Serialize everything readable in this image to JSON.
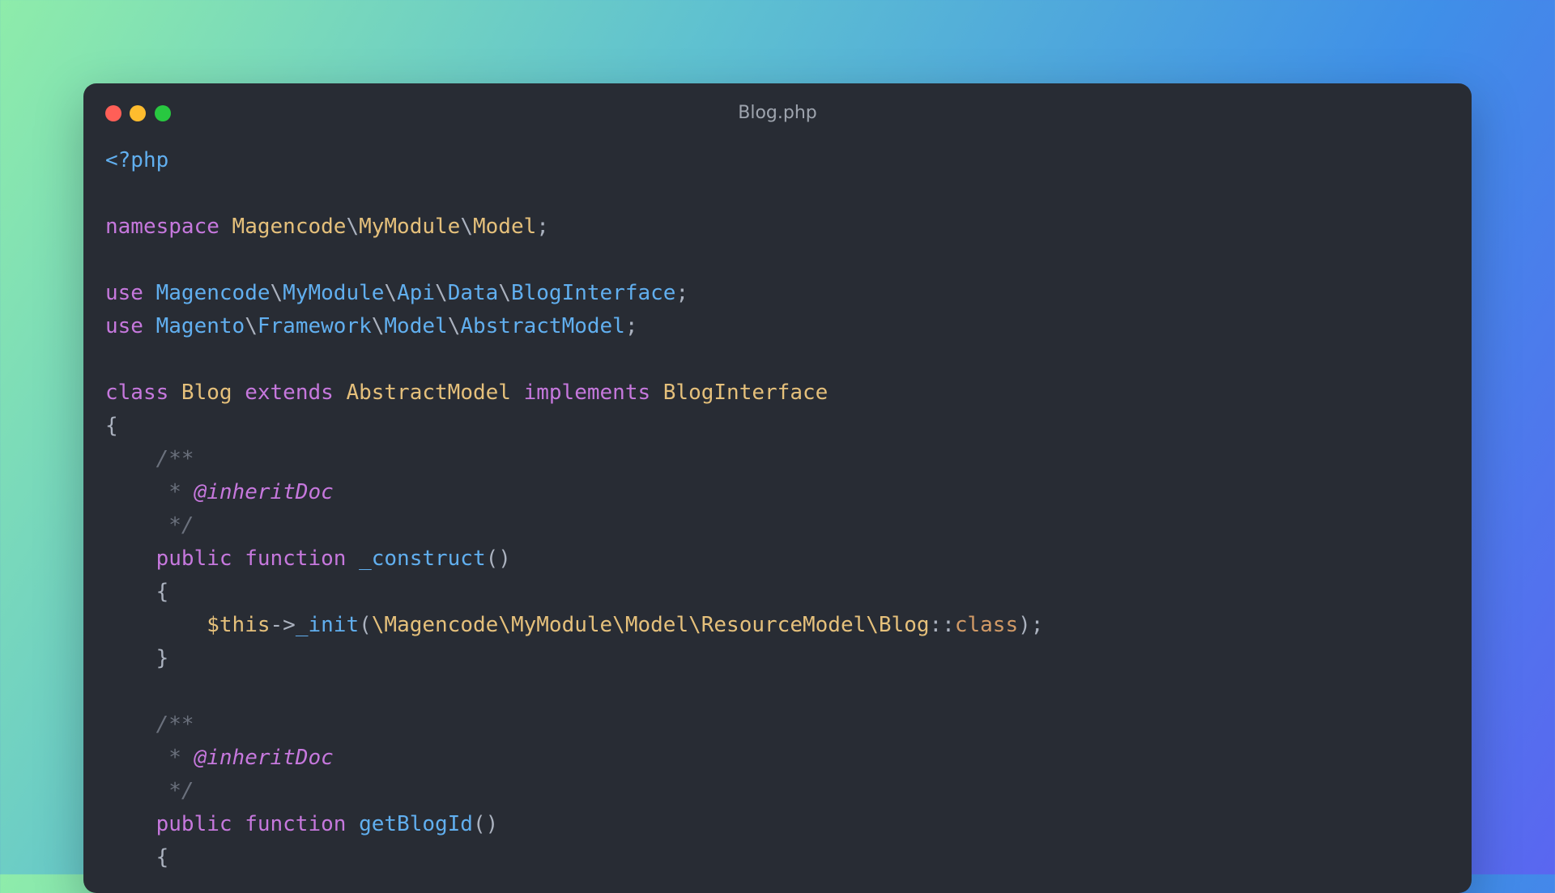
{
  "window": {
    "title": "Blog.php"
  },
  "code_lines": [
    [
      {
        "t": "<?php",
        "c": "tag"
      }
    ],
    [],
    [
      {
        "t": "namespace ",
        "c": "kw"
      },
      {
        "t": "Magencode",
        "c": "ns"
      },
      {
        "t": "\\",
        "c": "punc"
      },
      {
        "t": "MyModule",
        "c": "ns"
      },
      {
        "t": "\\",
        "c": "punc"
      },
      {
        "t": "Model",
        "c": "ns"
      },
      {
        "t": ";",
        "c": "punc"
      }
    ],
    [],
    [
      {
        "t": "use ",
        "c": "kw"
      },
      {
        "t": "Magencode",
        "c": "use"
      },
      {
        "t": "\\",
        "c": "punc"
      },
      {
        "t": "MyModule",
        "c": "use"
      },
      {
        "t": "\\",
        "c": "punc"
      },
      {
        "t": "Api",
        "c": "use"
      },
      {
        "t": "\\",
        "c": "punc"
      },
      {
        "t": "Data",
        "c": "use"
      },
      {
        "t": "\\",
        "c": "punc"
      },
      {
        "t": "BlogInterface",
        "c": "use"
      },
      {
        "t": ";",
        "c": "punc"
      }
    ],
    [
      {
        "t": "use ",
        "c": "kw"
      },
      {
        "t": "Magento",
        "c": "use"
      },
      {
        "t": "\\",
        "c": "punc"
      },
      {
        "t": "Framework",
        "c": "use"
      },
      {
        "t": "\\",
        "c": "punc"
      },
      {
        "t": "Model",
        "c": "use"
      },
      {
        "t": "\\",
        "c": "punc"
      },
      {
        "t": "AbstractModel",
        "c": "use"
      },
      {
        "t": ";",
        "c": "punc"
      }
    ],
    [],
    [
      {
        "t": "class ",
        "c": "kw"
      },
      {
        "t": "Blog ",
        "c": "cls"
      },
      {
        "t": "extends ",
        "c": "kw"
      },
      {
        "t": "AbstractModel ",
        "c": "cls"
      },
      {
        "t": "implements ",
        "c": "kw"
      },
      {
        "t": "BlogInterface",
        "c": "cls"
      }
    ],
    [
      {
        "t": "{",
        "c": "punc"
      }
    ],
    [
      {
        "t": "    /**",
        "c": "com"
      }
    ],
    [
      {
        "t": "     * ",
        "c": "com"
      },
      {
        "t": "@inheritDoc",
        "c": "doc"
      }
    ],
    [
      {
        "t": "     */",
        "c": "com"
      }
    ],
    [
      {
        "t": "    public ",
        "c": "kw"
      },
      {
        "t": "function ",
        "c": "kw"
      },
      {
        "t": "_construct",
        "c": "fn"
      },
      {
        "t": "()",
        "c": "punc"
      }
    ],
    [
      {
        "t": "    {",
        "c": "punc"
      }
    ],
    [
      {
        "t": "        ",
        "c": "punc"
      },
      {
        "t": "$this",
        "c": "var"
      },
      {
        "t": "->",
        "c": "punc"
      },
      {
        "t": "_init",
        "c": "fn"
      },
      {
        "t": "(",
        "c": "punc"
      },
      {
        "t": "\\Magencode\\MyModule\\Model\\ResourceModel\\Blog",
        "c": "str"
      },
      {
        "t": "::",
        "c": "punc"
      },
      {
        "t": "class",
        "c": "cc"
      },
      {
        "t": ");",
        "c": "punc"
      }
    ],
    [
      {
        "t": "    }",
        "c": "punc"
      }
    ],
    [],
    [
      {
        "t": "    /**",
        "c": "com"
      }
    ],
    [
      {
        "t": "     * ",
        "c": "com"
      },
      {
        "t": "@inheritDoc",
        "c": "doc"
      }
    ],
    [
      {
        "t": "     */",
        "c": "com"
      }
    ],
    [
      {
        "t": "    public ",
        "c": "kw"
      },
      {
        "t": "function ",
        "c": "kw"
      },
      {
        "t": "getBlogId",
        "c": "fn"
      },
      {
        "t": "()",
        "c": "punc"
      }
    ],
    [
      {
        "t": "    {",
        "c": "punc"
      }
    ]
  ]
}
